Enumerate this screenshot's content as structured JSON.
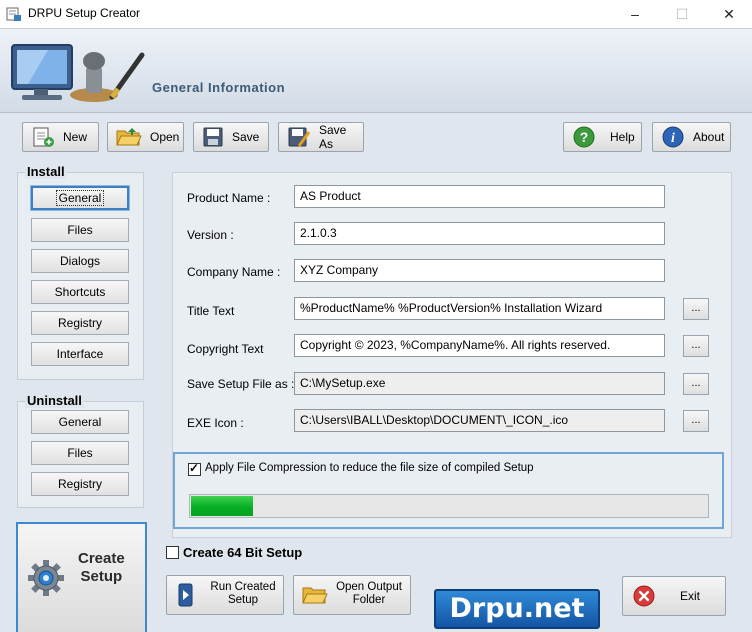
{
  "window": {
    "title": "DRPU Setup Creator",
    "minimize": "–",
    "maximize": "☐",
    "close": "✕"
  },
  "banner": {
    "heading": "General Information"
  },
  "toolbar": {
    "new": "New",
    "open": "Open",
    "save": "Save",
    "save_as": "Save As",
    "help": "Help",
    "about": "About"
  },
  "install": {
    "title": "Install",
    "items": [
      "General",
      "Files",
      "Dialogs",
      "Shortcuts",
      "Registry",
      "Interface"
    ],
    "active": "General"
  },
  "uninstall": {
    "title": "Uninstall",
    "items": [
      "General",
      "Files",
      "Registry"
    ]
  },
  "form": {
    "product_name": {
      "label": "Product Name :",
      "value": "AS Product"
    },
    "version": {
      "label": "Version :",
      "value": "2.1.0.3"
    },
    "company_name": {
      "label": "Company Name :",
      "value": "XYZ Company"
    },
    "title_text": {
      "label": "Title Text",
      "value": "%ProductName% %ProductVersion% Installation Wizard"
    },
    "copyright_text": {
      "label": "Copyright Text",
      "value": "Copyright © 2023, %CompanyName%. All rights reserved."
    },
    "save_setup_as": {
      "label": "Save Setup File as :",
      "value": "C:\\MySetup.exe"
    },
    "exe_icon": {
      "label": "EXE Icon :",
      "value": "C:\\Users\\IBALL\\Desktop\\DOCUMENT\\_ICON_.ico"
    },
    "browse_label": "..."
  },
  "compression": {
    "label": "Apply File Compression to reduce the file size of compiled Setup",
    "checked": true,
    "progress": 0.12
  },
  "bottom": {
    "create_setup_line1": "Create",
    "create_setup_line2": "Setup",
    "create_64bit": "Create 64 Bit Setup",
    "create_64bit_checked": false,
    "run_created_line1": "Run Created",
    "run_created_line2": "Setup",
    "open_output_line1": "Open Output",
    "open_output_line2": "Folder",
    "exit": "Exit",
    "brand": "Drpu.net"
  },
  "colors": {
    "accent": "#3b89d0",
    "progress_green": "#06b025",
    "exit_red": "#d93a3a"
  }
}
